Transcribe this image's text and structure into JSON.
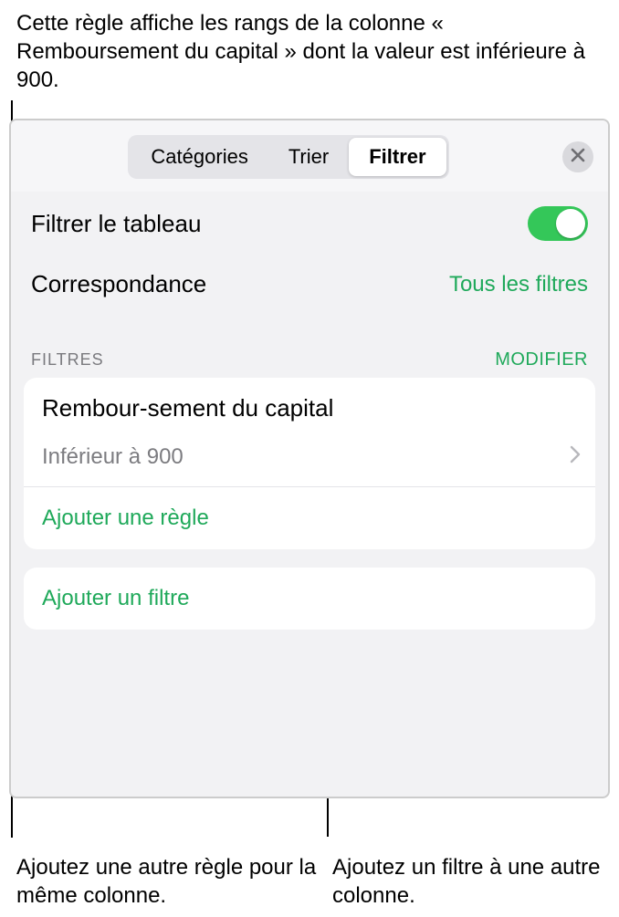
{
  "callouts": {
    "top": "Cette règle affiche les rangs de la colonne « Remboursement du capital » dont la valeur est inférieure à 900.",
    "bottom_left": "Ajoutez une autre règle pour la même colonne.",
    "bottom_right": "Ajoutez un filtre à une autre colonne."
  },
  "segmented": {
    "categories": "Catégories",
    "sort": "Trier",
    "filter": "Filtrer"
  },
  "rows": {
    "filter_table_label": "Filtrer le tableau",
    "match_label": "Correspondance",
    "match_value": "Tous les filtres"
  },
  "section": {
    "title": "FILTRES",
    "edit": "MODIFIER"
  },
  "filter_card": {
    "column_name": "Rembour-sement du capital",
    "rule_text": "Inférieur à 900",
    "add_rule": "Ajouter une règle"
  },
  "add_filter_card": {
    "label": "Ajouter un filtre"
  },
  "colors": {
    "accent": "#1fa95a",
    "toggle_on": "#34c759"
  }
}
